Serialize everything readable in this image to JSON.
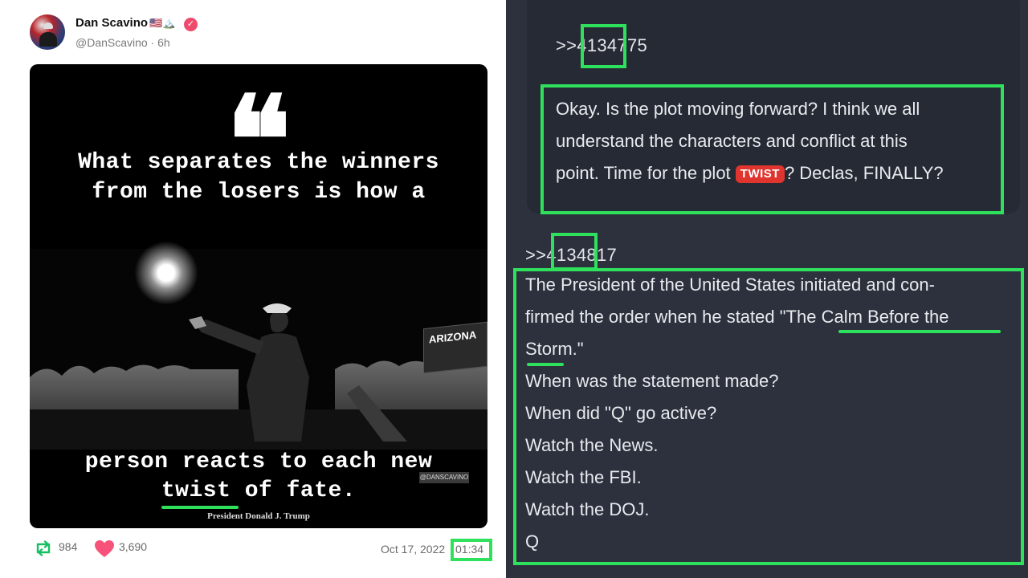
{
  "tweet": {
    "display_name": "Dan Scavino",
    "name_emoji": "🇺🇸🏔️",
    "verified_icon": "verified-badge-icon",
    "handle_time": "@DanScavino · 6h",
    "image": {
      "quote_marks": "❝",
      "quote_line_1": "What separates the winners",
      "quote_line_2": "from the losers is how a",
      "quote_line_3": "person reacts to each new",
      "quote_line_4_word": "twist",
      "quote_line_4_rest": " of fate.",
      "attribution": "President Donald J. Trump",
      "sign_text": "ARIZONA",
      "watermark": "@DANSCAVINO"
    },
    "retweet_count": "984",
    "like_count": "3,690",
    "date": "Oct 17, 2022",
    "time": "01:34"
  },
  "board": {
    "post1": {
      "ref": ">>4134775",
      "text_1": "Okay. Is the plot moving forward? I think we all",
      "text_2": "understand the characters and conflict at this",
      "text_3a": "point. Time for the plot ",
      "badge": "TWIST",
      "text_3b": "? Declas, FINALLY?"
    },
    "post2": {
      "ref": ">>4134817",
      "lines": [
        "The President of the United States initiated and con-",
        "firmed the order when he stated \"The Calm Before the",
        "Storm.\"",
        "When was the statement made?",
        "When did \"Q\" go active?",
        "Watch the News.",
        "Watch the FBI.",
        "Watch the DOJ.",
        "Q"
      ]
    }
  },
  "colors": {
    "highlight": "#2fe05c",
    "badge_red": "#e0342f",
    "dark_panel": "#2c313d",
    "heart": "#f7527a",
    "retweet": "#17bf63"
  }
}
